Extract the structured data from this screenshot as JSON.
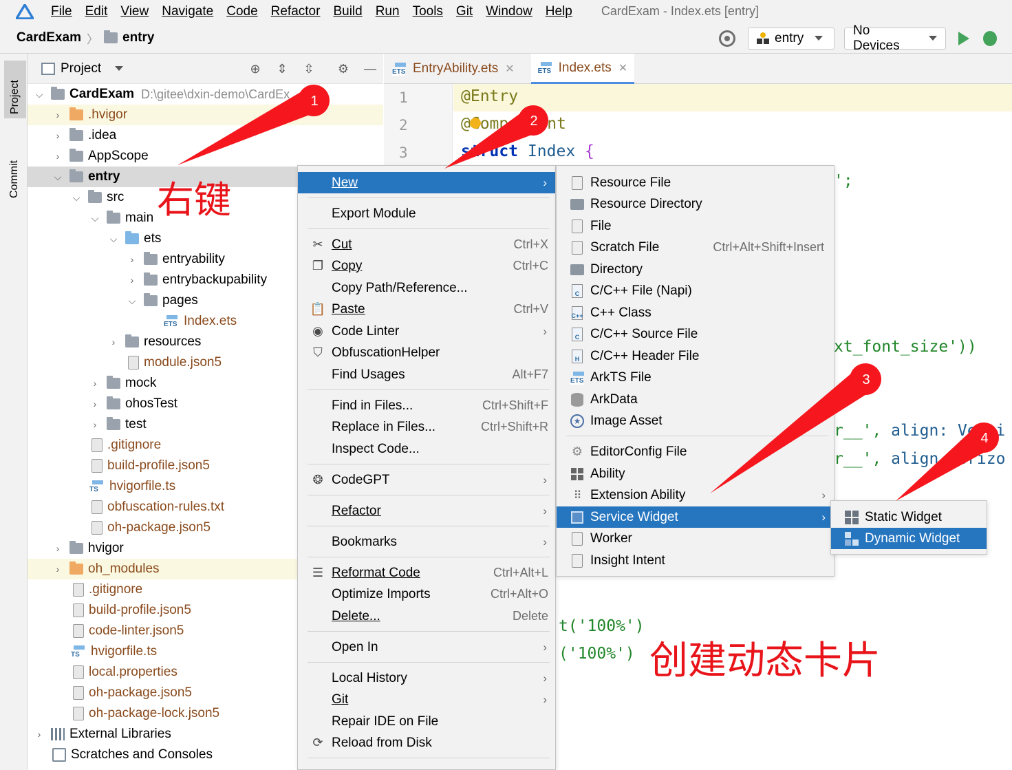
{
  "menubar": {
    "items": [
      "File",
      "Edit",
      "View",
      "Navigate",
      "Code",
      "Refactor",
      "Build",
      "Run",
      "Tools",
      "Git",
      "Window",
      "Help"
    ],
    "title": "CardExam - Index.ets [entry]"
  },
  "navbar": {
    "breadcrumb": [
      "CardExam",
      "entry"
    ],
    "run_config": "entry",
    "device": "No Devices"
  },
  "toolstrip": {
    "project_tab": "Project",
    "commit_tab": "Commit"
  },
  "project_panel": {
    "title": "Project",
    "tree": [
      {
        "label": "CardExam",
        "path": "D:\\gitee\\dxin-demo\\CardEx"
      },
      {
        "label": ".hvigor"
      },
      {
        "label": ".idea"
      },
      {
        "label": "AppScope"
      },
      {
        "label": "entry"
      },
      {
        "label": "src"
      },
      {
        "label": "main"
      },
      {
        "label": "ets"
      },
      {
        "label": "entryability"
      },
      {
        "label": "entrybackupability"
      },
      {
        "label": "pages"
      },
      {
        "label": "Index.ets"
      },
      {
        "label": "resources"
      },
      {
        "label": "module.json5"
      },
      {
        "label": "mock"
      },
      {
        "label": "ohosTest"
      },
      {
        "label": "test"
      },
      {
        "label": ".gitignore"
      },
      {
        "label": "build-profile.json5"
      },
      {
        "label": "hvigorfile.ts"
      },
      {
        "label": "obfuscation-rules.txt"
      },
      {
        "label": "oh-package.json5"
      },
      {
        "label": "hvigor"
      },
      {
        "label": "oh_modules"
      },
      {
        "label": ".gitignore"
      },
      {
        "label": "build-profile.json5"
      },
      {
        "label": "code-linter.json5"
      },
      {
        "label": "hvigorfile.ts"
      },
      {
        "label": "local.properties"
      },
      {
        "label": "oh-package.json5"
      },
      {
        "label": "oh-package-lock.json5"
      },
      {
        "label": "External Libraries"
      },
      {
        "label": "Scratches and Consoles"
      }
    ]
  },
  "editor": {
    "tabs": [
      {
        "label": "EntryAbility.ets"
      },
      {
        "label": "Index.ets"
      }
    ],
    "line_numbers": [
      "1",
      "2",
      "3"
    ],
    "code": {
      "l1": "@Entry",
      "l2a": "@Comp",
      "l2b": "nt",
      "l3a": "struct",
      "l3b": " Index ",
      "l3c": "{",
      "frag1": "';",
      "frag2": "xt_font_size'))",
      "frag3a": "r__', ",
      "frag3b": "align: ",
      "frag3c": "Verti",
      "frag4a": "r__', ",
      "frag4b": "align",
      "frag4c": "Horizo",
      "frag5": "t('100%')",
      "frag6": "('100%')"
    }
  },
  "context_menu": {
    "items": [
      {
        "label": "New"
      },
      {
        "label": "Export Module"
      },
      {
        "label": "Cut",
        "shortcut": "Ctrl+X"
      },
      {
        "label": "Copy",
        "shortcut": "Ctrl+C"
      },
      {
        "label": "Copy Path/Reference..."
      },
      {
        "label": "Paste",
        "shortcut": "Ctrl+V"
      },
      {
        "label": "Code Linter"
      },
      {
        "label": "ObfuscationHelper"
      },
      {
        "label": "Find Usages",
        "shortcut": "Alt+F7"
      },
      {
        "label": "Find in Files...",
        "shortcut": "Ctrl+Shift+F"
      },
      {
        "label": "Replace in Files...",
        "shortcut": "Ctrl+Shift+R"
      },
      {
        "label": "Inspect Code..."
      },
      {
        "label": "CodeGPT"
      },
      {
        "label": "Refactor"
      },
      {
        "label": "Bookmarks"
      },
      {
        "label": "Reformat Code",
        "shortcut": "Ctrl+Alt+L"
      },
      {
        "label": "Optimize Imports",
        "shortcut": "Ctrl+Alt+O"
      },
      {
        "label": "Delete...",
        "shortcut": "Delete"
      },
      {
        "label": "Open In"
      },
      {
        "label": "Local History"
      },
      {
        "label": "Git"
      },
      {
        "label": "Repair IDE on File"
      },
      {
        "label": "Reload from Disk"
      }
    ]
  },
  "new_submenu": {
    "items": [
      {
        "label": "Resource File"
      },
      {
        "label": "Resource Directory"
      },
      {
        "label": "File"
      },
      {
        "label": "Scratch File",
        "shortcut": "Ctrl+Alt+Shift+Insert"
      },
      {
        "label": "Directory"
      },
      {
        "label": "C/C++ File (Napi)"
      },
      {
        "label": "C++ Class"
      },
      {
        "label": "C/C++ Source File"
      },
      {
        "label": "C/C++ Header File"
      },
      {
        "label": "ArkTS File"
      },
      {
        "label": "ArkData"
      },
      {
        "label": "Image Asset"
      },
      {
        "label": "EditorConfig File"
      },
      {
        "label": "Ability"
      },
      {
        "label": "Extension Ability"
      },
      {
        "label": "Service Widget"
      },
      {
        "label": "Worker"
      },
      {
        "label": "Insight Intent"
      }
    ]
  },
  "widget_submenu": {
    "items": [
      {
        "label": "Static Widget"
      },
      {
        "label": "Dynamic Widget"
      }
    ]
  },
  "annotations": {
    "right_click_text": "右键",
    "create_text": "创建动态卡片",
    "steps": [
      "1",
      "2",
      "3",
      "4"
    ]
  },
  "colors": {
    "menu_selection": "#2675bf",
    "annotation_red": "#e8141a",
    "file_brown": "#8a4a1c"
  }
}
